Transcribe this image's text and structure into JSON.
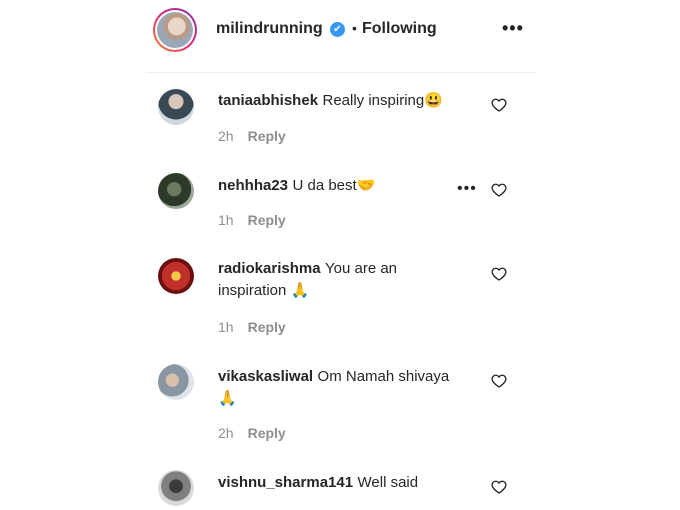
{
  "post": {
    "username": "milindrunning",
    "verified_mark": "✔",
    "separator": "•",
    "follow_status": "Following",
    "more_options": "•••"
  },
  "comments": [
    {
      "username": "taniaabhishek",
      "text": "Really inspiring",
      "emoji": "😃",
      "time": "2h",
      "reply": "Reply"
    },
    {
      "username": "nehhha23",
      "text": "U da best",
      "emoji": "🤝",
      "time": "1h",
      "reply": "Reply",
      "more": "•••"
    },
    {
      "username": "radiokarishma",
      "text_line1": "You are an",
      "text_line2": "inspiration",
      "emoji": "🙏",
      "time": "1h",
      "reply": "Reply"
    },
    {
      "username": "vikaskasliwal",
      "text": "Om Namah shivaya",
      "emoji": "🙏",
      "time": "2h",
      "reply": "Reply"
    },
    {
      "username": "vishnu_sharma141",
      "text": "Well said"
    }
  ]
}
